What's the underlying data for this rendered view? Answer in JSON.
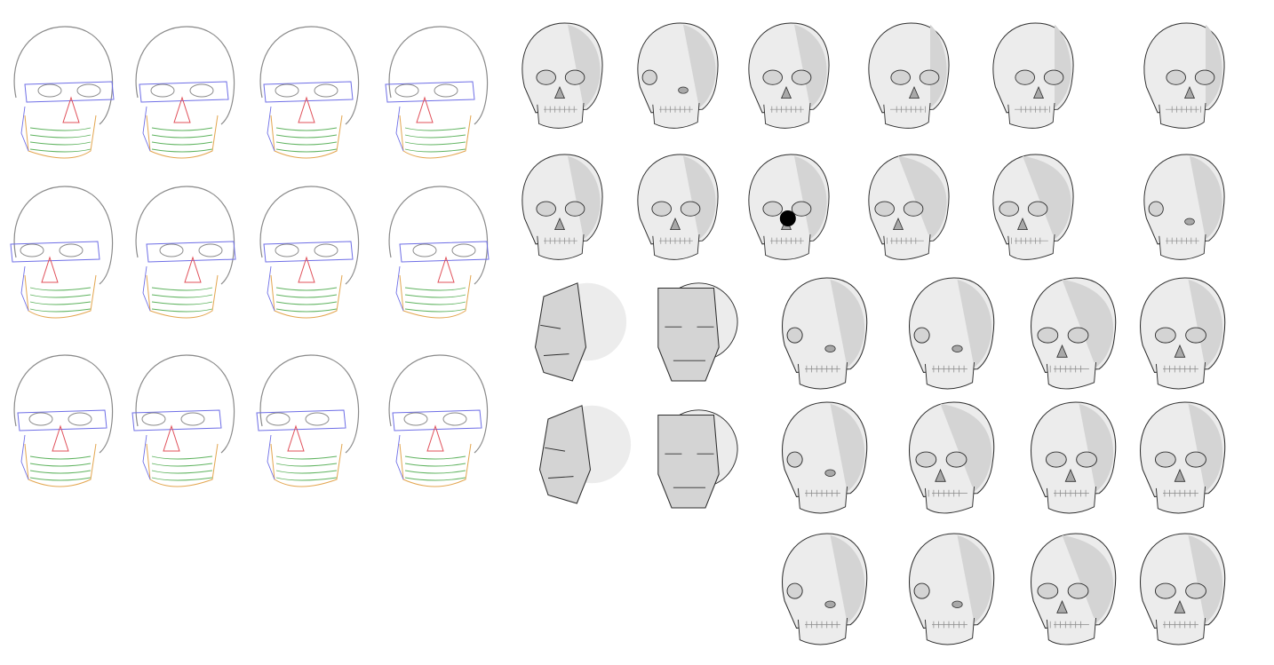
{
  "page": {
    "background": "#ffffff"
  },
  "palette": {
    "line_dark": "#2e2e2e",
    "line_light": "#8a8a8a",
    "fill_light": "#ececec",
    "fill_mid": "#d4d4d4",
    "fill_dark": "#a9a9a9",
    "fill_black": "#000000",
    "construction_blue": "#6e6ee6",
    "construction_red": "#e0505a",
    "construction_green": "#5fb35f",
    "construction_orange": "#e3a650"
  },
  "groups": {
    "construction_sketches": {
      "count": 12,
      "style": "colored-construction-lines"
    },
    "skull_studies_top": {
      "count": 12,
      "style": "grey-shaded"
    },
    "head_planes": {
      "count": 4,
      "style": "planar-head"
    },
    "skull_studies_bottom": {
      "count": 12,
      "style": "grey-shaded"
    }
  }
}
